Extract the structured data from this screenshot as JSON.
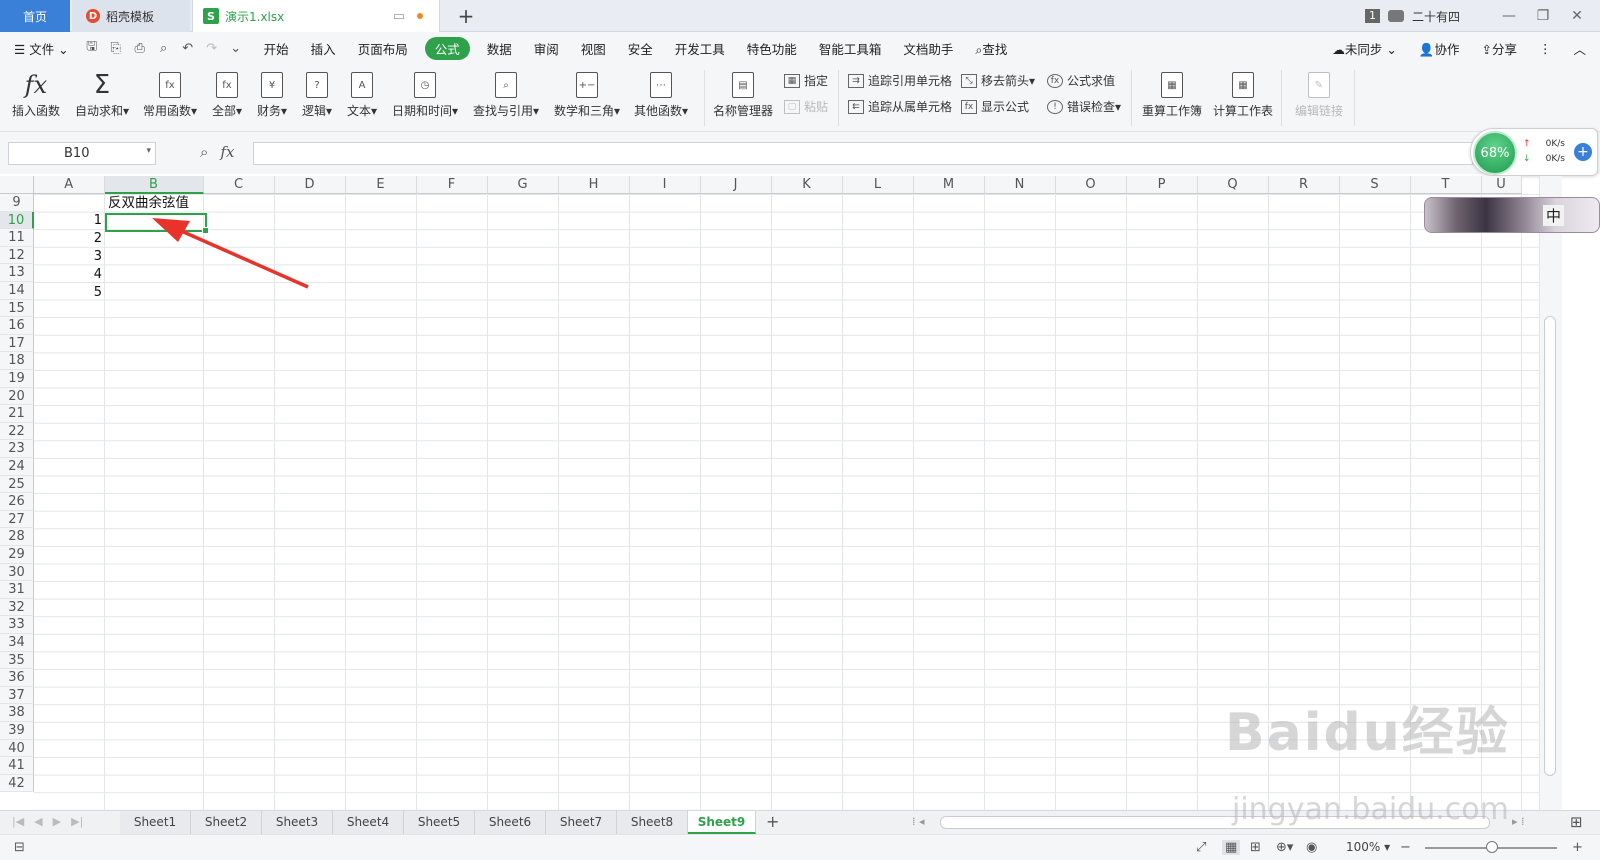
{
  "tabs": {
    "home": "首页",
    "template": "稻壳模板",
    "doc": "演示1.xlsx",
    "doc_icon_letter": "S",
    "template_icon_letter": "D"
  },
  "window": {
    "badge": "1",
    "user": "二十有四"
  },
  "menu": {
    "file": "文件",
    "items": [
      "开始",
      "插入",
      "页面布局",
      "公式",
      "数据",
      "审阅",
      "视图",
      "安全",
      "开发工具",
      "特色功能",
      "智能工具箱",
      "文档助手"
    ],
    "active": "公式",
    "search": "查找",
    "sync": "未同步",
    "collab": "协作",
    "share": "分享"
  },
  "ribbon": {
    "insert_fn": "插入函数",
    "autosum": "自动求和",
    "common_fn": "常用函数",
    "all": "全部",
    "finance": "财务",
    "logic": "逻辑",
    "text": "文本",
    "datetime": "日期和时间",
    "lookup": "查找与引用",
    "math": "数学和三角",
    "other": "其他函数",
    "name_mgr": "名称管理器",
    "specify": "指定",
    "paste": "粘贴",
    "trace_pre": "追踪引用单元格",
    "trace_dep": "追踪从属单元格",
    "remove_arrows": "移去箭头",
    "show_formula": "显示公式",
    "eval_formula": "公式求值",
    "error_check": "错误检查",
    "recalc_book": "重算工作簿",
    "calc_sheet": "计算工作表",
    "edit_links": "编辑链接"
  },
  "formula_bar": {
    "name_box": "B10",
    "fx": "fx",
    "value": ""
  },
  "speed": {
    "percent": "68%",
    "up": "0K/s",
    "down": "0K/s"
  },
  "grid": {
    "columns": [
      "A",
      "B",
      "C",
      "D",
      "E",
      "F",
      "G",
      "H",
      "I",
      "J",
      "K",
      "L",
      "M",
      "N",
      "O",
      "P",
      "Q",
      "R",
      "S",
      "T",
      "U"
    ],
    "selected_column": "B",
    "rows": [
      9,
      10,
      11,
      12,
      13,
      14,
      15,
      16,
      17,
      18,
      19,
      20,
      21,
      22,
      23,
      24,
      25,
      26,
      27,
      28,
      29,
      30,
      31,
      32,
      33,
      34,
      35,
      36,
      37,
      38,
      39,
      40,
      41,
      42
    ],
    "selected_row": 10,
    "b9": "反双曲余弦值",
    "a_values": [
      "1",
      "2",
      "3",
      "4",
      "5"
    ]
  },
  "ime_label": "中",
  "sheets": [
    "Sheet1",
    "Sheet2",
    "Sheet3",
    "Sheet4",
    "Sheet5",
    "Sheet6",
    "Sheet7",
    "Sheet8",
    "Sheet9"
  ],
  "active_sheet": "Sheet9",
  "status": {
    "zoom": "100%"
  },
  "watermark": {
    "main": "Baidu经验",
    "sub": "jingyan.baidu.com"
  },
  "colors": {
    "accent": "#2ea14a",
    "tab_home": "#3a80d8",
    "arrow": "#e8332a"
  }
}
